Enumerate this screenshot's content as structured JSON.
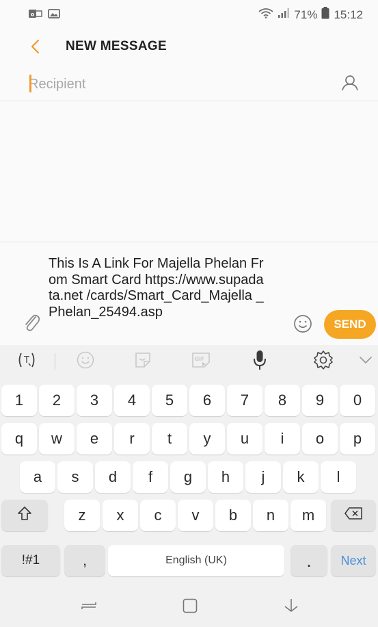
{
  "status_bar": {
    "battery_percent": "71%",
    "time": "15:12",
    "icons": [
      "outlook-notification-icon",
      "image-notification-icon",
      "wifi-icon",
      "signal-icon",
      "battery-icon"
    ]
  },
  "header": {
    "title": "NEW MESSAGE",
    "back_icon": "chevron-left-icon"
  },
  "recipient": {
    "placeholder": "Recipient",
    "value": "",
    "contact_icon": "person-icon"
  },
  "compose": {
    "message": "This Is A Link For Majella Phelan From Smart Card https://www.supadata.net /cards/Smart_Card_Majella _Phelan_25494.asp",
    "attach_icon": "paperclip-icon",
    "emoji_icon": "emoji-icon",
    "send_label": "SEND"
  },
  "keyboard_toolbar": {
    "items": [
      "text-translate-icon",
      "emoji-icon",
      "sticker-icon",
      "gif-icon",
      "microphone-icon",
      "settings-gear-icon",
      "chevron-down-icon"
    ]
  },
  "keyboard": {
    "row1": [
      "1",
      "2",
      "3",
      "4",
      "5",
      "6",
      "7",
      "8",
      "9",
      "0"
    ],
    "row2": [
      "q",
      "w",
      "e",
      "r",
      "t",
      "y",
      "u",
      "i",
      "o",
      "p"
    ],
    "row3": [
      "a",
      "s",
      "d",
      "f",
      "g",
      "h",
      "j",
      "k",
      "l"
    ],
    "row4": [
      "z",
      "x",
      "c",
      "v",
      "b",
      "n",
      "m"
    ],
    "symbols_label": "!#1",
    "comma_label": ",",
    "space_label": "English (UK)",
    "period_label": ".",
    "next_label": "Next"
  },
  "nav_bar": {
    "items": [
      "recent-apps-icon",
      "home-icon",
      "back-icon"
    ]
  },
  "colors": {
    "accent": "#f5a623",
    "next_key_text": "#4a8fd8",
    "background": "#fafafa"
  }
}
